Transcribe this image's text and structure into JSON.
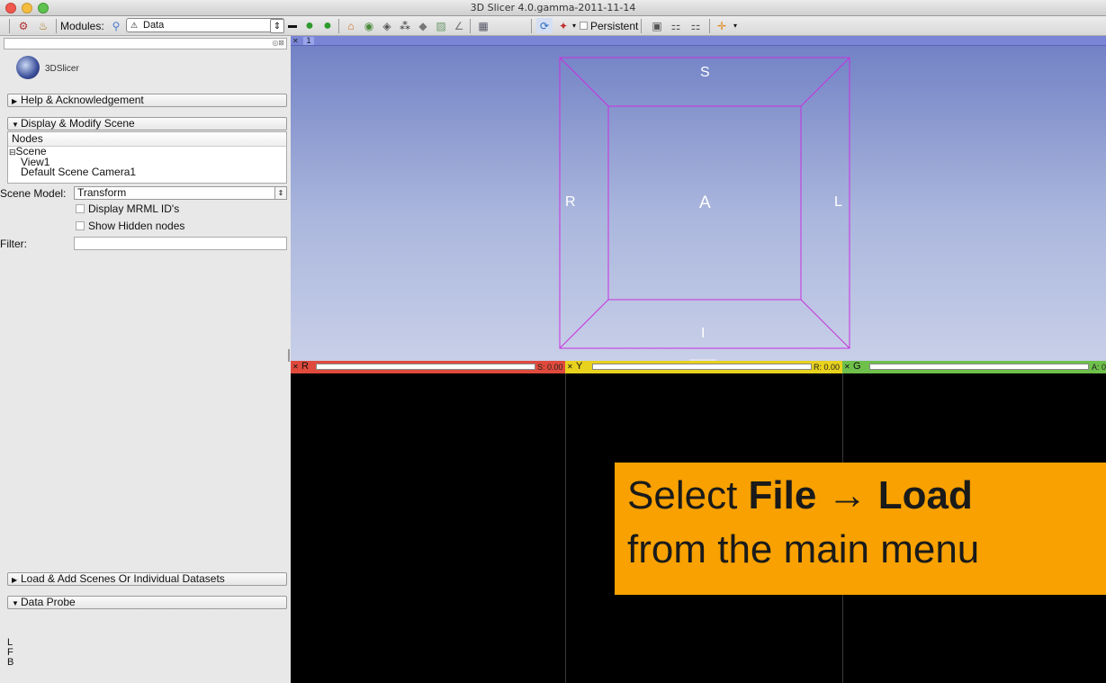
{
  "window": {
    "title": "3D Slicer 4.0.gamma-2011-11-14"
  },
  "toolbar": {
    "modules_label": "Modules:",
    "module_value": "Data",
    "persistent_label": "Persistent"
  },
  "panel": {
    "logo_text": "3DSlicer",
    "sections": {
      "help": "Help & Acknowledgement",
      "display": "Display & Modify Scene",
      "load": "Load & Add Scenes Or Individual Datasets",
      "probe": "Data Probe"
    },
    "tree": {
      "header": "Nodes",
      "root": "Scene",
      "children": [
        "View1",
        "Default Scene Camera1"
      ]
    },
    "scene_model_label": "Scene Model:",
    "scene_model_value": "Transform",
    "display_ids_label": "Display MRML ID's",
    "hidden_nodes_label": "Show Hidden nodes",
    "filter_label": "Filter:",
    "probe_lines": [
      "L",
      "F",
      "B"
    ]
  },
  "view3d": {
    "number": "1",
    "axes": {
      "top": "S",
      "bottom": "I",
      "left": "R",
      "right": "L",
      "center": "A"
    }
  },
  "slices": [
    {
      "name": "R",
      "value": "S: 0.00",
      "color": "#e04a3c"
    },
    {
      "name": "Y",
      "value": "R: 0.00",
      "color": "#e8d21e"
    },
    {
      "name": "G",
      "value": "A: 0",
      "color": "#6ec04a"
    }
  ],
  "callout": {
    "line1_pre": "Select ",
    "line1_b1": "File",
    "line1_arrow": " → ",
    "line1_b2": "Load",
    "line2": "from the main menu"
  }
}
